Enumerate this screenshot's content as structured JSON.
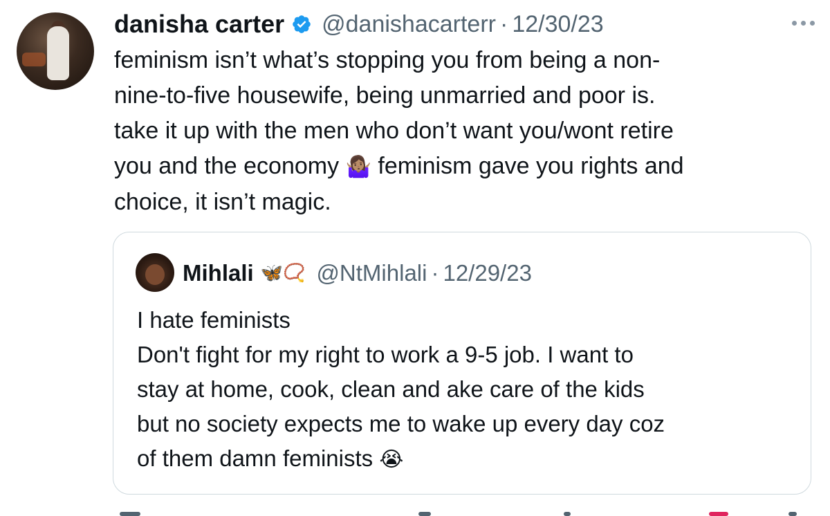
{
  "tweet": {
    "author_name": "danisha carter",
    "handle": "@danishacarterr",
    "separator": "·",
    "date": "12/30/23",
    "verified_color": "#1d9bf0",
    "lines": [
      "feminism isn’t what’s stopping you from being a non-",
      "nine-to-five housewife, being unmarried and poor is.",
      "take it up with the men who don’t want you/wont retire",
      "choice, it isn’t magic."
    ],
    "line4_before_emoji": "you and the economy ",
    "line4_emoji": "🤷🏽‍♀️",
    "line4_after_emoji": " feminism gave you rights and"
  },
  "quote": {
    "author_name": "Mihlali",
    "badges": "🦋📿",
    "handle": "@NtMihlali",
    "separator": "·",
    "date": "12/29/23",
    "lines": [
      "I hate feminists",
      "Don't fight for my right to work a 9-5 job. I want to",
      "stay at home, cook, clean and ake care of the kids",
      "but no society expects me to wake up every day coz"
    ],
    "last_line_text": "of them damn feminists ",
    "last_line_emoji": "😭"
  },
  "icons": {
    "verified": "verified-badge-icon",
    "more": "more-options-icon"
  }
}
